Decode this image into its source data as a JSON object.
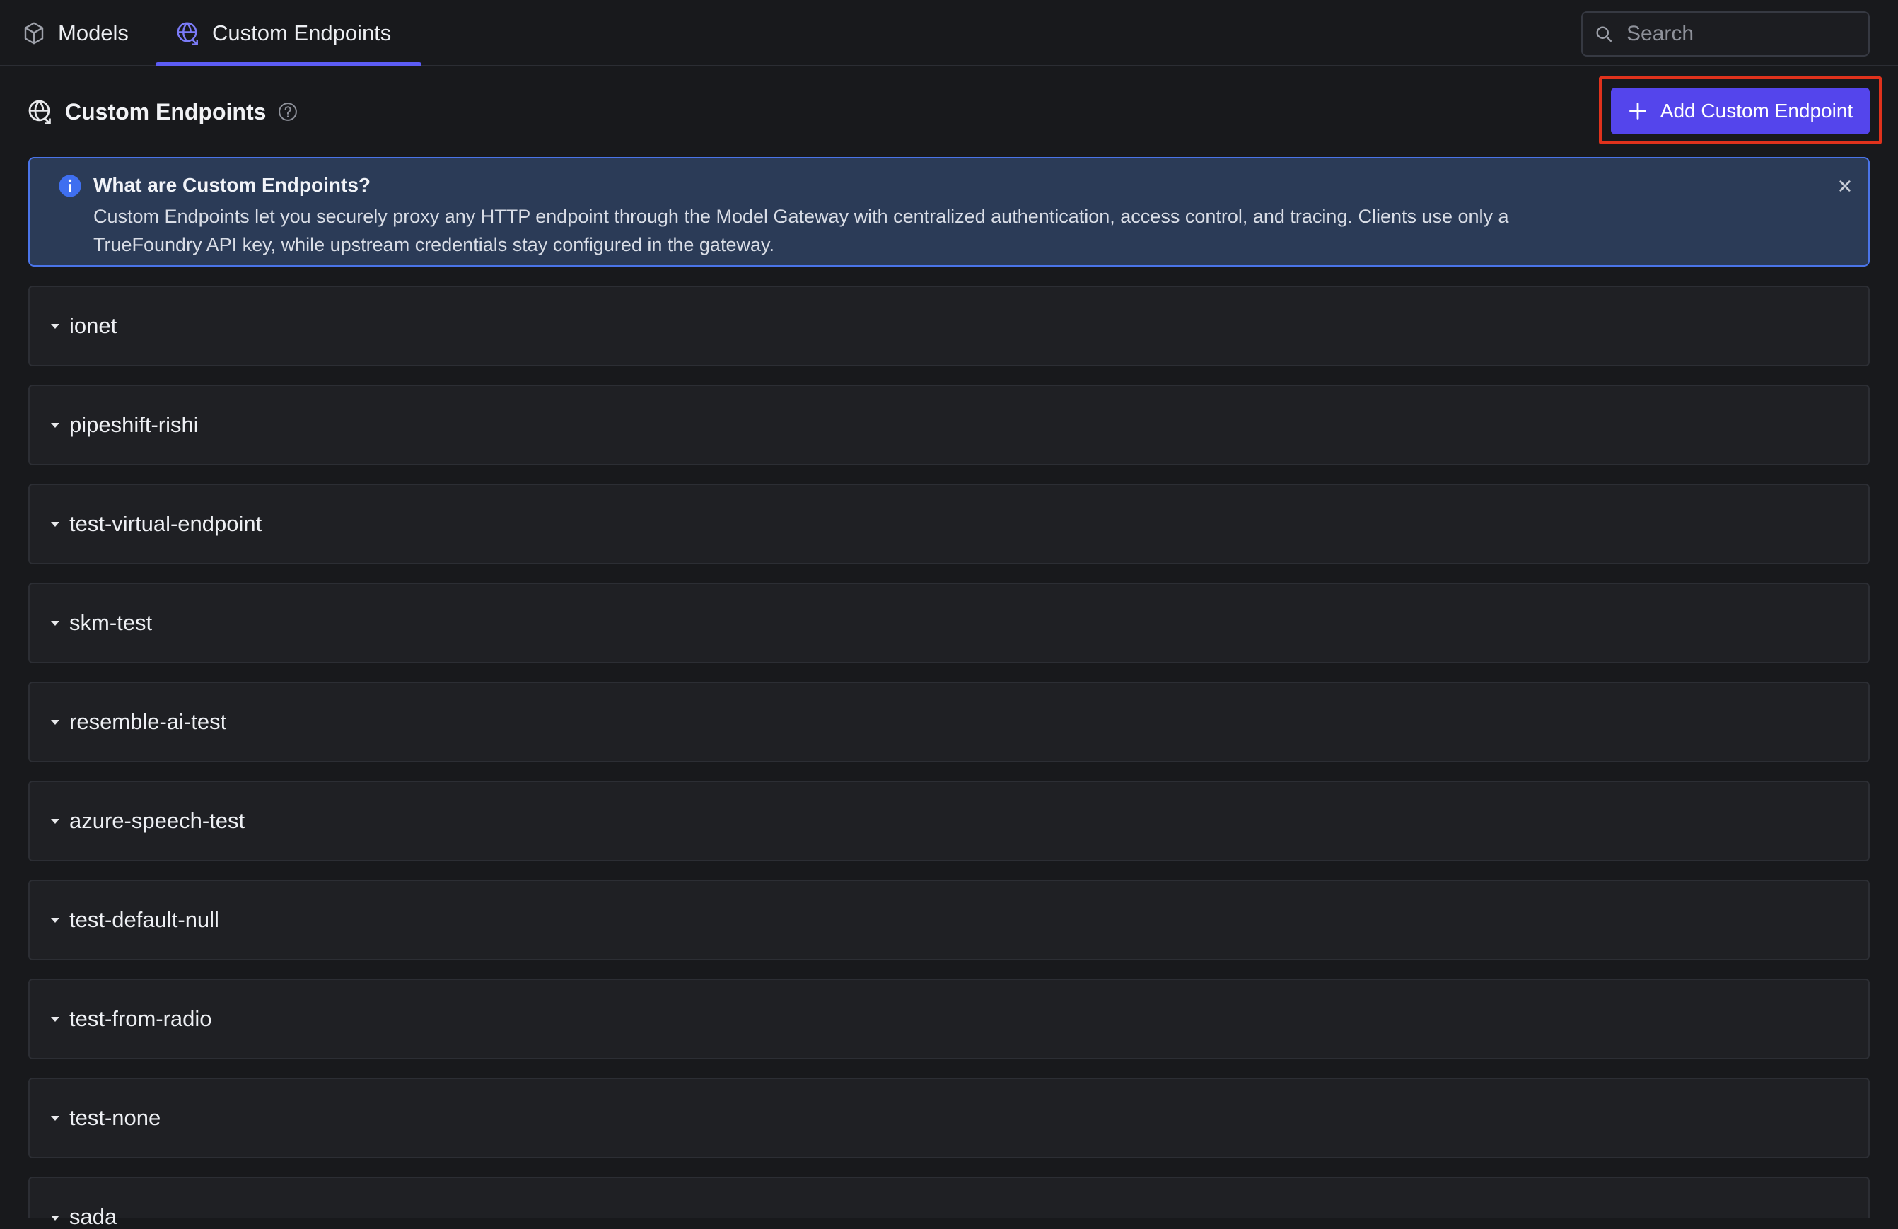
{
  "tabs": [
    {
      "label": "Models",
      "icon": "cube-icon",
      "active": false
    },
    {
      "label": "Custom Endpoints",
      "icon": "globe-icon",
      "active": true
    }
  ],
  "search": {
    "placeholder": "Search"
  },
  "header": {
    "title": "Custom Endpoints",
    "help_icon": "help-circle-icon"
  },
  "add_button": {
    "label": "Add Custom Endpoint",
    "icon": "plus-icon"
  },
  "banner": {
    "title": "What are Custom Endpoints?",
    "body_line1": "Custom Endpoints let you securely proxy any HTTP endpoint through the Model Gateway with centralized authentication, access control, and tracing. Clients use only a",
    "body_line2": "TrueFoundry API key, while upstream credentials stay configured in the gateway."
  },
  "endpoints": [
    "ionet",
    "pipeshift-rishi",
    "test-virtual-endpoint",
    "skm-test",
    "resemble-ai-test",
    "azure-speech-test",
    "test-default-null",
    "test-from-radio",
    "test-none",
    "sada"
  ],
  "colors": {
    "background": "#18191c",
    "accent": "#5c5cf5",
    "button": "#5445ec",
    "highlight_outline": "#e0321c",
    "banner_bg": "#2b3b57",
    "banner_border": "#4a74e8"
  }
}
